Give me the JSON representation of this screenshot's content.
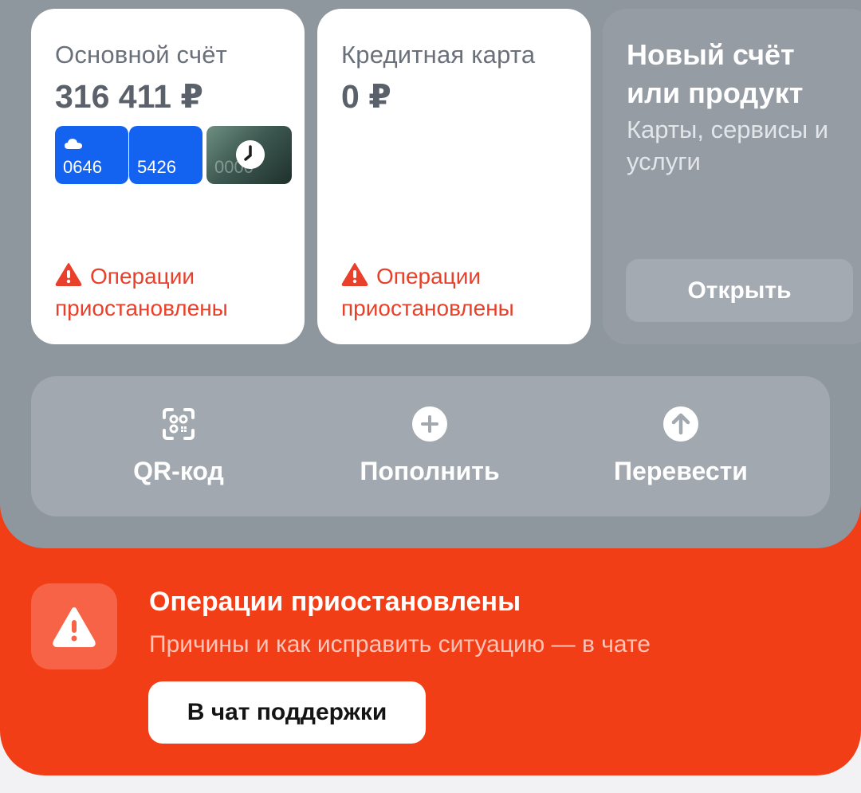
{
  "accounts": {
    "main": {
      "title": "Основной счёт",
      "balance": "316 411 ₽",
      "cards": [
        {
          "number": "0646",
          "icon": "cloud-icon"
        },
        {
          "number": "5426"
        },
        {
          "number": "0000",
          "icon": "clock-icon"
        }
      ],
      "warning": "Операции приостановлены"
    },
    "credit": {
      "title": "Кредитная карта",
      "balance": "0 ₽",
      "warning": "Операции приостановлены"
    },
    "new_product": {
      "title": "Новый счёт или продукт",
      "subtitle": "Карты, сервисы и услуги",
      "button": "Открыть"
    }
  },
  "actions": [
    {
      "label": "QR-код",
      "icon": "qr-scan-icon"
    },
    {
      "label": "Пополнить",
      "icon": "plus-circle-icon"
    },
    {
      "label": "Перевести",
      "icon": "arrow-up-circle-icon"
    }
  ],
  "alert": {
    "title": "Операции приостановлены",
    "subtitle": "Причины и как исправить ситуацию — в чате",
    "button": "В чат поддержки",
    "icon": "warning-icon"
  },
  "colors": {
    "alert_red": "#f23e16",
    "warning_text": "#e8402a",
    "card_blue": "#1463f0",
    "panel_gray": "#8e969e"
  }
}
